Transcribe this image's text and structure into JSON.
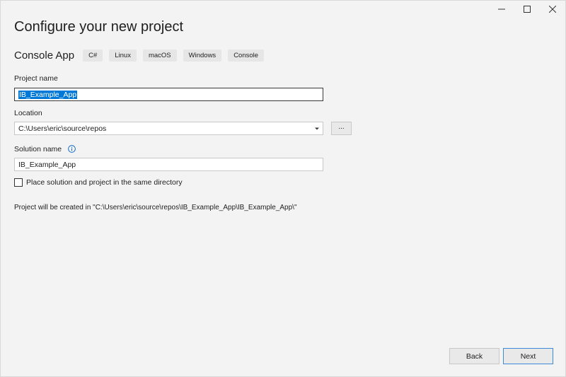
{
  "window": {
    "controls": [
      "minimize",
      "maximize",
      "close"
    ]
  },
  "header": {
    "title": "Configure your new project"
  },
  "template": {
    "name": "Console App",
    "tags": [
      "C#",
      "Linux",
      "macOS",
      "Windows",
      "Console"
    ]
  },
  "form": {
    "project_name": {
      "label": "Project name",
      "value": "IB_Example_App"
    },
    "location": {
      "label": "Location",
      "value": "C:\\Users\\eric\\source\\repos",
      "browse_label": "..."
    },
    "solution_name": {
      "label": "Solution name",
      "value": "IB_Example_App",
      "info_icon": "info-icon"
    },
    "same_directory": {
      "label": "Place solution and project in the same directory",
      "checked": false
    },
    "path_note": "Project will be created in \"C:\\Users\\eric\\source\\repos\\IB_Example_App\\IB_Example_App\\\""
  },
  "footer": {
    "back_label": "Back",
    "next_label": "Next"
  },
  "colors": {
    "selection": "#0078d7",
    "primary_border": "#3c8ad8",
    "background": "#f3f3f3"
  }
}
